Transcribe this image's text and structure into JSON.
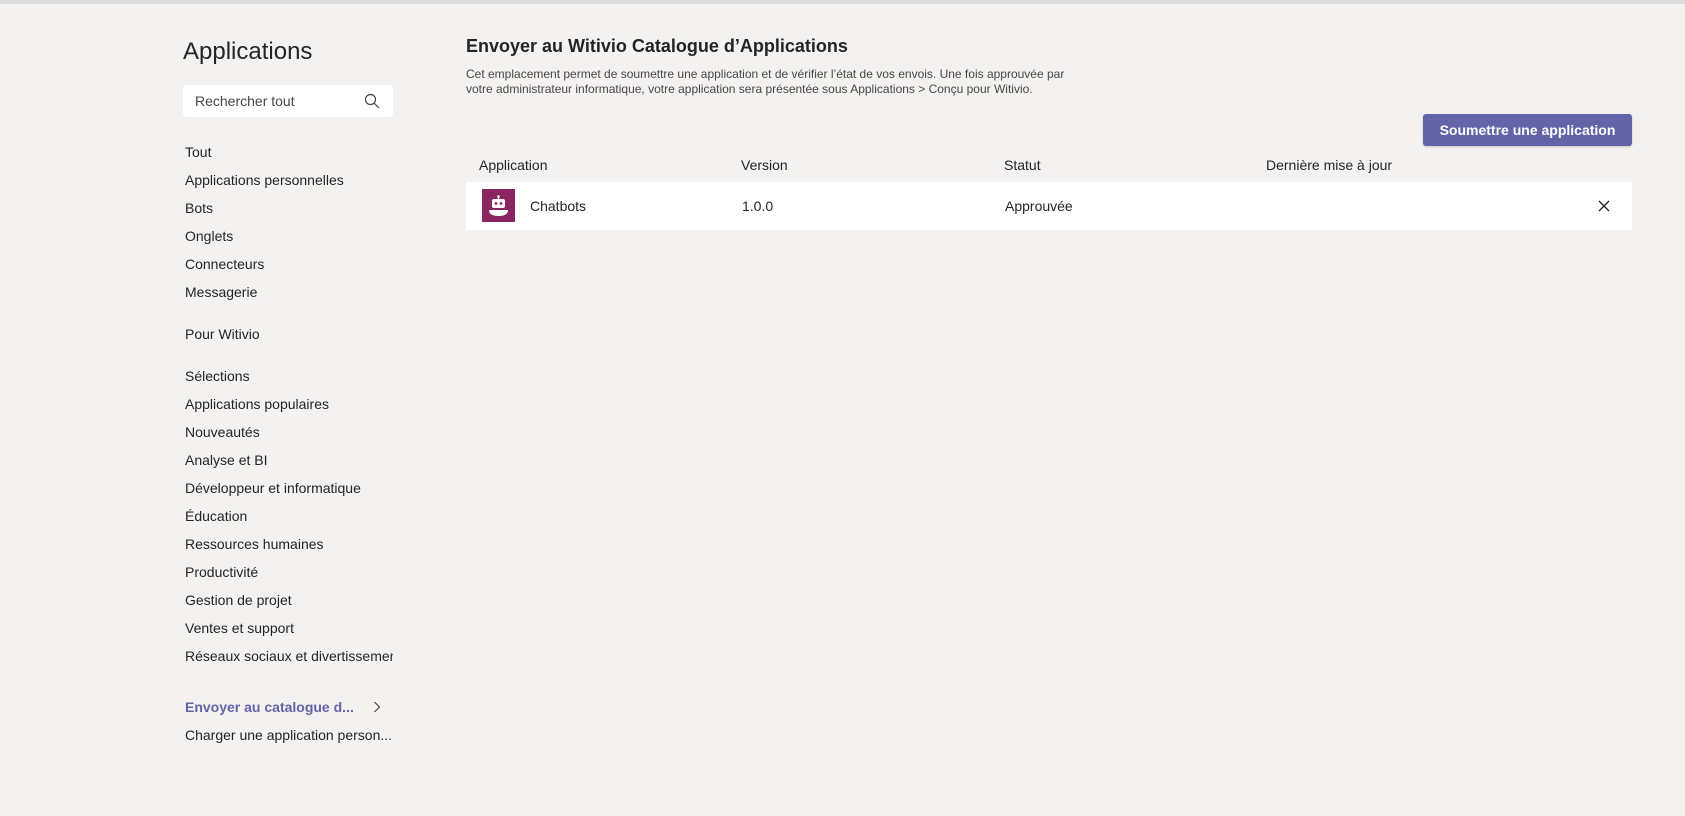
{
  "sidebar": {
    "title": "Applications",
    "search_placeholder": "Rechercher tout",
    "categories": [
      "Tout",
      "Applications personnelles",
      "Bots",
      "Onglets",
      "Connecteurs",
      "Messagerie"
    ],
    "org_section": "Pour Witivio",
    "topics": [
      "Sélections",
      "Applications populaires",
      "Nouveautés",
      "Analyse et BI",
      "Développeur et informatique",
      "Éducation",
      "Ressources humaines",
      "Productivité",
      "Gestion de projet",
      "Ventes et support",
      "Réseaux sociaux et divertissement"
    ],
    "actions": {
      "submit_catalog": "Envoyer au catalogue d...",
      "upload_custom": "Charger une application person..."
    }
  },
  "main": {
    "title": "Envoyer au Witivio Catalogue d’Applications",
    "description": "Cet emplacement permet de soumettre une application et de vérifier l’état de vos envois. Une fois approuvée par votre administrateur informatique, votre application sera présentée sous Applications > Conçu pour Witivio.",
    "submit_button": "Soumettre une application",
    "columns": {
      "application": "Application",
      "version": "Version",
      "status": "Statut",
      "last_updated": "Dernière mise à jour"
    },
    "rows": [
      {
        "name": "Chatbots",
        "version": "1.0.0",
        "status": "Approuvée",
        "last_updated": "",
        "icon": "robot-icon",
        "icon_color": "#8b2561"
      }
    ]
  },
  "colors": {
    "background": "#f3f2f1",
    "accent": "#6264a7",
    "app_icon": "#8b2561"
  }
}
